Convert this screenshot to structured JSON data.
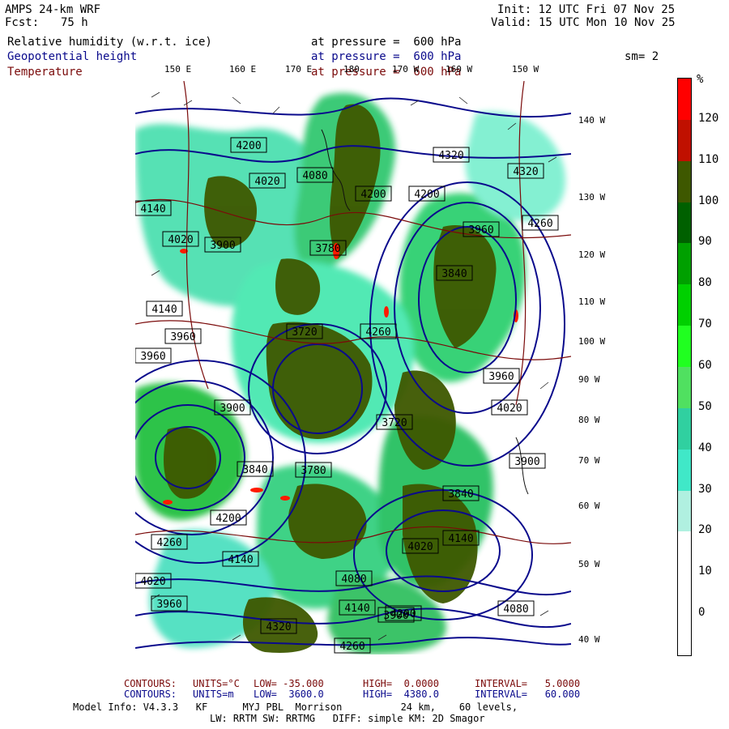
{
  "header": {
    "model": "AMPS 24-km WRF",
    "fcst_label": "Fcst:",
    "fcst_value": "75 h",
    "init": "Init: 12 UTC Fri 07 Nov 25",
    "valid": "Valid: 15 UTC Mon 10 Nov 25"
  },
  "fields": [
    {
      "name": "Relative humidity (w.r.t. ice)",
      "level": "at pressure =  600 hPa",
      "color": "#000000"
    },
    {
      "name": "Geopotential height",
      "level": "at pressure =  600 hPa",
      "color": "#0a0a8c"
    },
    {
      "name": "Temperature",
      "level": "at pressure =  600 hPa",
      "color": "#7a0a0a"
    }
  ],
  "smoothing": "sm= 2",
  "top_lon_labels": [
    "150 E",
    "160 E",
    "170 E",
    "180",
    "170 W",
    "160 W",
    "150 W"
  ],
  "right_lon_labels": [
    "140 W",
    "130 W",
    "120 W",
    "110 W",
    "100 W",
    "90 W",
    "80 W",
    "70 W",
    "60 W",
    "50 W",
    "40 W"
  ],
  "height_labels": [
    "4200",
    "4320",
    "4080",
    "4020",
    "4200",
    "4200",
    "4320",
    "4140",
    "4020",
    "4260",
    "3960",
    "3840",
    "3780",
    "3900",
    "3720",
    "4260",
    "3960",
    "4140",
    "3960",
    "3900",
    "3840",
    "4140",
    "4200",
    "4260",
    "4020",
    "3960",
    "4080",
    "4200",
    "4020",
    "4140",
    "4320",
    "4260",
    "4140",
    "3900",
    "3780",
    "3840",
    "3720",
    "3900",
    "4020",
    "3960",
    "4080"
  ],
  "colorbar": {
    "unit": "%",
    "ticks": [
      "120",
      "110",
      "100",
      "90",
      "80",
      "70",
      "60",
      "50",
      "40",
      "30",
      "20",
      "10",
      "0"
    ],
    "colors": [
      "#ff0000",
      "#c01000",
      "#3e5800",
      "#006000",
      "#00a000",
      "#00d000",
      "#20ff20",
      "#50e060",
      "#30d0a0",
      "#40e8c8",
      "#b0f0e0",
      "#ffffff",
      "#ffffff",
      "#ffffff"
    ]
  },
  "footer": {
    "line1": {
      "label": "CONTOURS:",
      "units": "UNITS=°C",
      "low": "LOW= -35.000",
      "high": "HIGH=  0.0000",
      "interval": "INTERVAL=   5.0000"
    },
    "line2": {
      "label": "CONTOURS:",
      "units": "UNITS=m",
      "low": "LOW=  3600.0",
      "high": "HIGH=  4380.0",
      "interval": "INTERVAL=   60.000"
    },
    "line3": "Model Info: V4.3.3   KF      MYJ PBL  Morrison          24 km,    60 levels,",
    "line4": "LW: RRTM SW: RRTMG   DIFF: simple KM: 2D Smagor"
  }
}
